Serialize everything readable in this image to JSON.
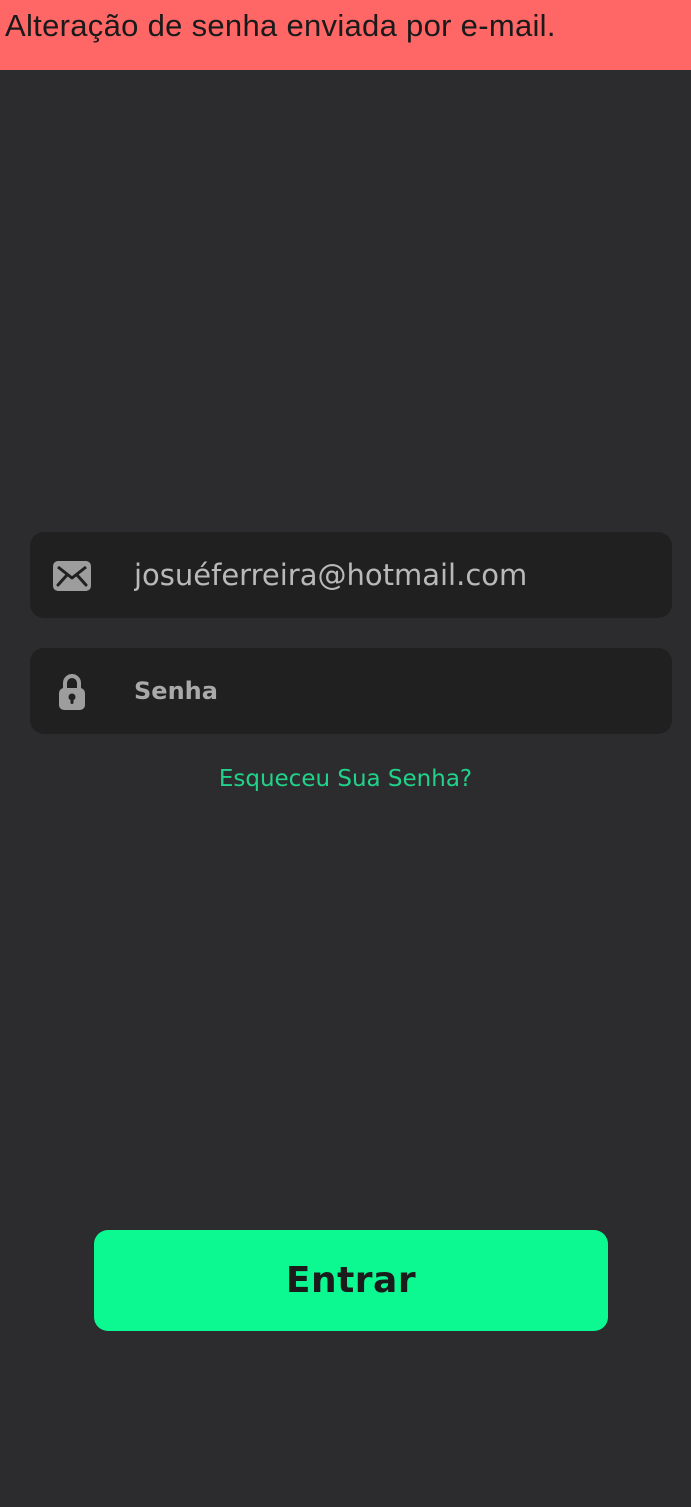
{
  "banner": {
    "message": "Alteração de senha enviada por e-mail."
  },
  "login": {
    "email_value": "josuéferreira@hotmail.com",
    "email_icon": "envelope-icon",
    "password_placeholder": "Senha",
    "password_icon": "padlock-icon",
    "forgot_label": "Esqueceu Sua Senha?",
    "submit_label": "Entrar"
  },
  "colors": {
    "background": "#2c2c2e",
    "banner": "#ff6666",
    "field": "#202021",
    "accent_link": "#21d38a",
    "button": "#0cf992"
  }
}
